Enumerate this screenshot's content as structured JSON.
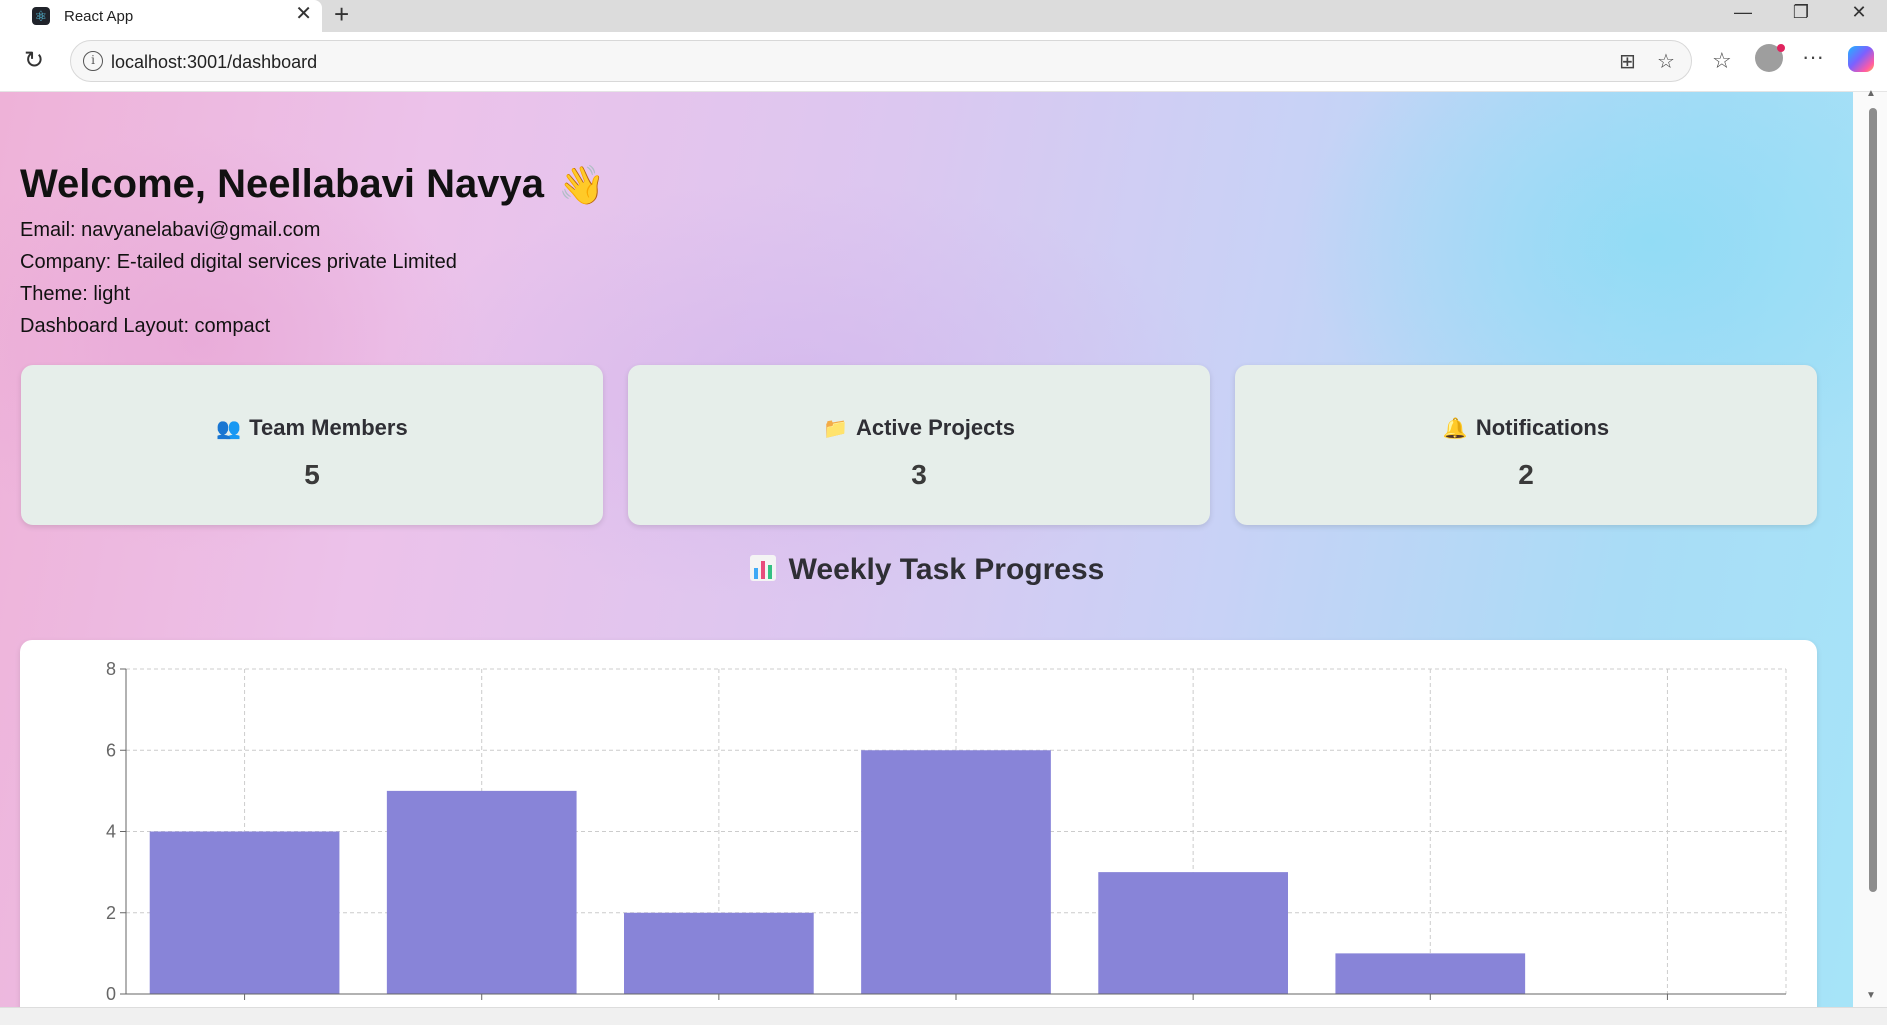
{
  "browser": {
    "tab_title": "React App",
    "url": "localhost:3001/dashboard",
    "favicon": "react-icon"
  },
  "dashboard": {
    "welcome": "Welcome, Neellabavi Navya",
    "wave_emoji": "👋",
    "email_line": "Email: navyanelabavi@gmail.com",
    "company_line": "Company: E-tailed digital services private Limited",
    "theme_line": "Theme: light",
    "layout_line": "Dashboard Layout: compact"
  },
  "cards": [
    {
      "icon": "👥",
      "label": "Team Members",
      "value": "5"
    },
    {
      "icon": "📁",
      "label": "Active Projects",
      "value": "3"
    },
    {
      "icon": "🔔",
      "label": "Notifications",
      "value": "2"
    }
  ],
  "section": {
    "title": "Weekly Task Progress"
  },
  "chart_data": {
    "type": "bar",
    "categories": [
      "",
      "",
      "",
      "",
      "",
      "",
      ""
    ],
    "values": [
      4,
      5,
      2,
      6,
      3,
      1,
      0
    ],
    "ylim": [
      0,
      8
    ],
    "yticks": [
      "0",
      "2",
      "4",
      "6",
      "8"
    ],
    "grid": true,
    "bar_color": "#8884d8"
  }
}
